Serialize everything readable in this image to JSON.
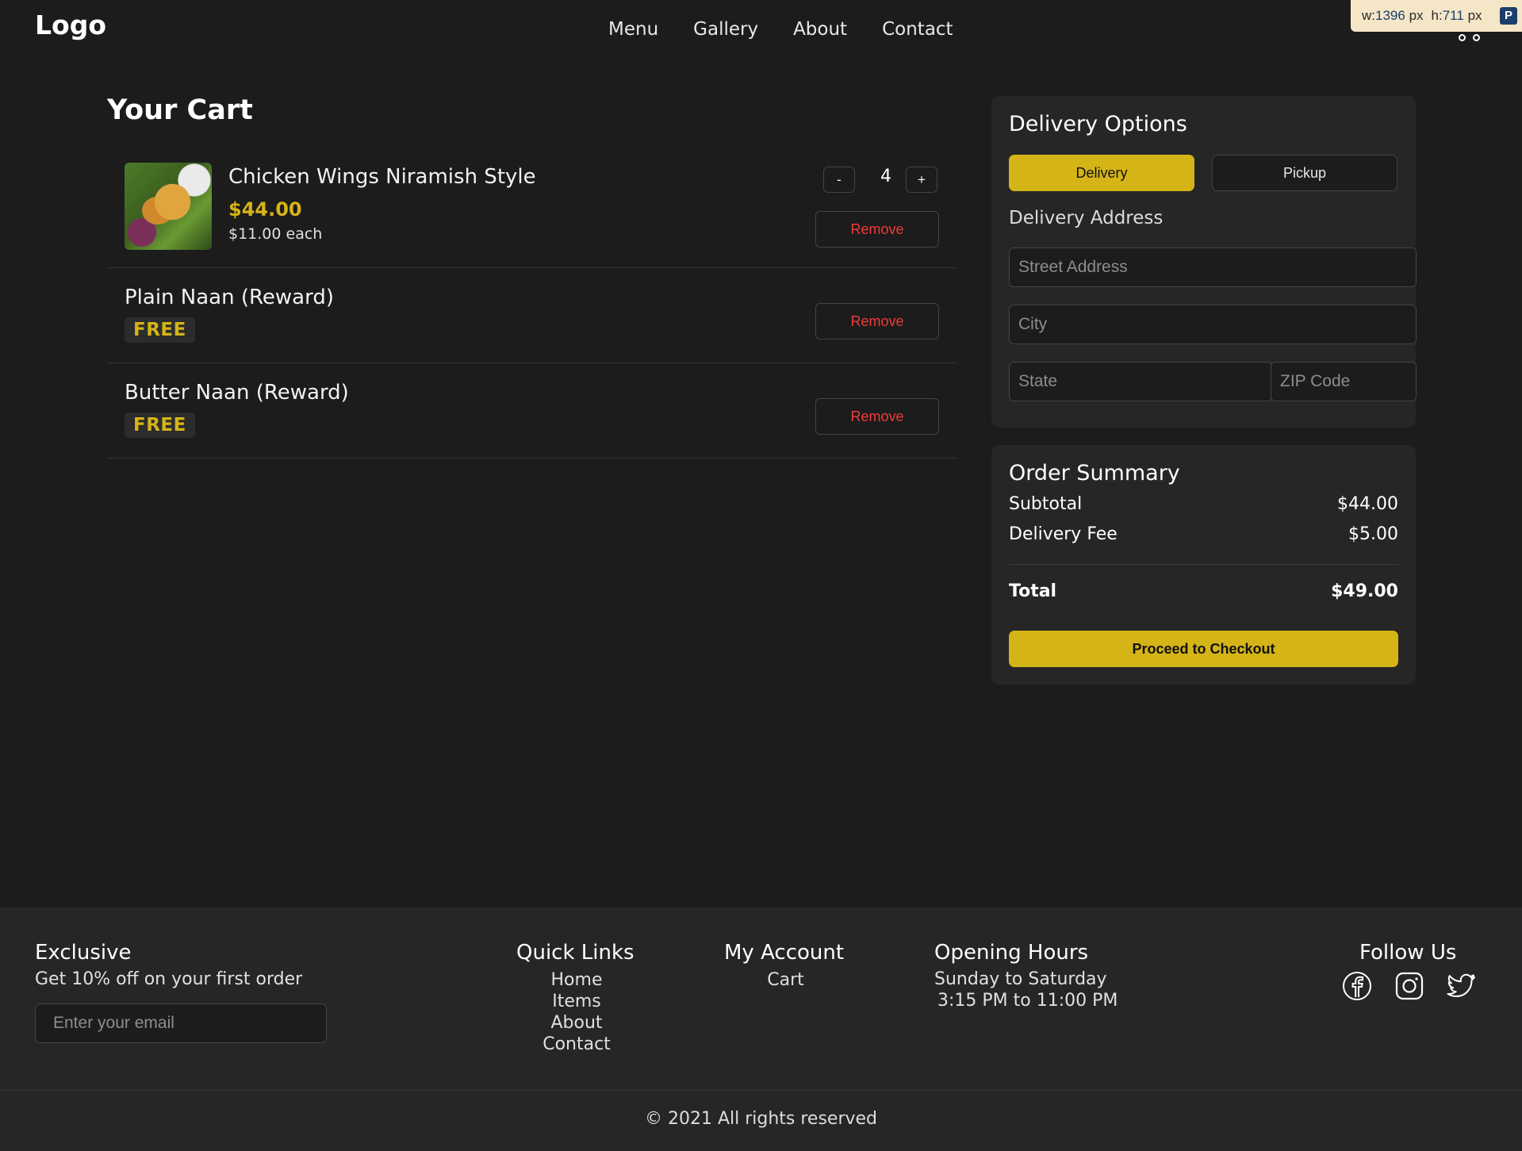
{
  "header": {
    "logo": "Logo",
    "nav": [
      "Menu",
      "Gallery",
      "About",
      "Contact"
    ],
    "size_badge": {
      "w_label": "w:",
      "w_value": "1396",
      "w_unit": "px",
      "h_label": "h:",
      "h_value": "711",
      "h_unit": "px"
    }
  },
  "cart": {
    "title": "Your Cart",
    "items": [
      {
        "name": "Chicken Wings Niramish Style",
        "price": "$44.00",
        "each": "$11.00 each",
        "qty": "4",
        "minus": "-",
        "plus": "+",
        "remove": "Remove"
      },
      {
        "name": "Plain Naan (Reward)",
        "badge": "FREE",
        "remove": "Remove"
      },
      {
        "name": "Butter Naan (Reward)",
        "badge": "FREE",
        "remove": "Remove"
      }
    ]
  },
  "delivery": {
    "title": "Delivery Options",
    "options": [
      "Delivery",
      "Pickup"
    ],
    "selected": "Delivery",
    "address_label": "Delivery Address",
    "placeholders": {
      "street": "Street Address",
      "city": "City",
      "state": "State",
      "zip": "ZIP Code"
    }
  },
  "summary": {
    "title": "Order Summary",
    "subtotal_label": "Subtotal",
    "subtotal": "$44.00",
    "fee_label": "Delivery Fee",
    "fee": "$5.00",
    "total_label": "Total",
    "total": "$49.00",
    "checkout": "Proceed to Checkout"
  },
  "footer": {
    "exclusive_title": "Exclusive",
    "exclusive_text": "Get 10% off on your first order",
    "email_placeholder": "Enter your email",
    "quick_links_title": "Quick Links",
    "quick_links": [
      "Home",
      "Items",
      "About",
      "Contact"
    ],
    "account_title": "My Account",
    "account_links": [
      "Cart"
    ],
    "hours_title": "Opening Hours",
    "hours_days": "Sunday to Saturday",
    "hours_time": "3:15 PM to 11:00 PM",
    "follow_title": "Follow Us",
    "social_icons": [
      "facebook-icon",
      "instagram-icon",
      "twitter-icon"
    ],
    "copyright": "© 2021 All rights reserved"
  },
  "colors": {
    "accent": "#d4b416",
    "danger": "#ef3b3b",
    "background": "#1c1c1c",
    "panel": "#262626"
  }
}
